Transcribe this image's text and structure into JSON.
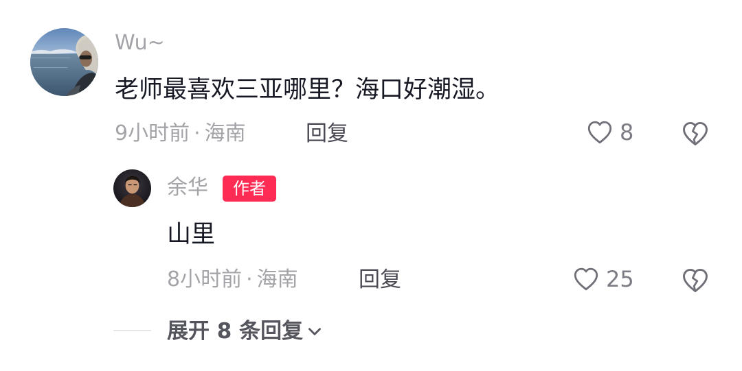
{
  "comment": {
    "username": "Wu~",
    "avatar": "avatar-landscape-photo",
    "text": "老师最喜欢三亚哪里？海口好潮湿。",
    "time": "9小时前",
    "separator": "·",
    "location": "海南",
    "reply_label": "回复",
    "like_icon": "heart-outline-icon",
    "like_count": "8",
    "dislike_icon": "broken-heart-icon"
  },
  "reply": {
    "username": "余华",
    "avatar": "avatar-portrait-photo",
    "author_badge": "作者",
    "author_badge_color": "#fe2c55",
    "text": "山里",
    "time": "8小时前",
    "separator": "·",
    "location": "海南",
    "reply_label": "回复",
    "like_icon": "heart-outline-icon",
    "like_count": "25",
    "dislike_icon": "broken-heart-icon"
  },
  "expand": {
    "label": "展开 8 条回复",
    "icon": "chevron-down-icon"
  }
}
